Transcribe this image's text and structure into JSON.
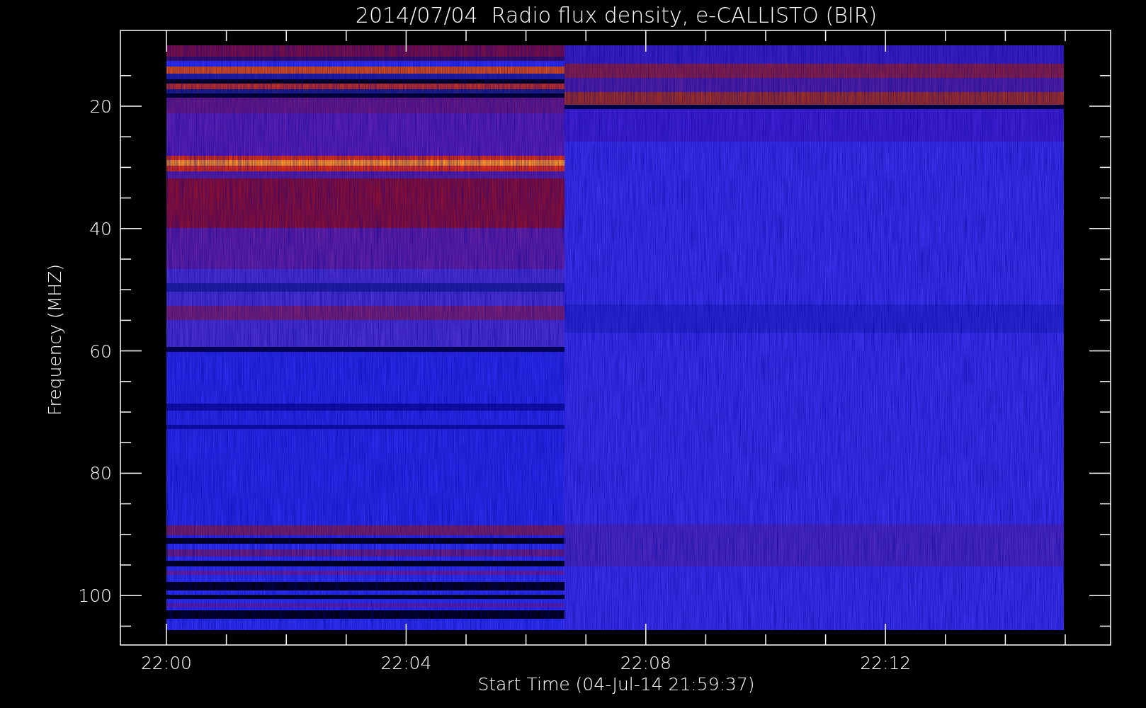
{
  "title": "2014/07/04  Radio flux density, e-CALLISTO (BIR)",
  "y_axis": {
    "label": "Frequency (MHZ)",
    "ticks": [
      "20",
      "40",
      "60",
      "80",
      "100"
    ]
  },
  "x_axis": {
    "label": "Start Time (04-Jul-14 21:59:37)",
    "ticks": [
      "22:00",
      "22:04",
      "22:08",
      "22:12"
    ]
  }
}
